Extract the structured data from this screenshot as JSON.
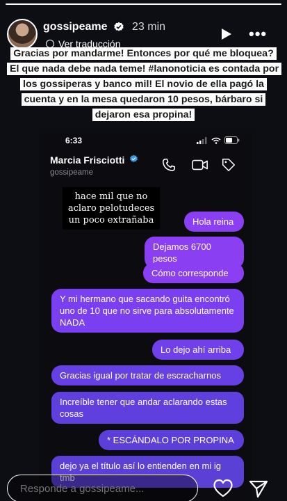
{
  "story": {
    "username": "gossipeame",
    "time_ago": "23 min",
    "translate_label": "Ver traducción",
    "caption": "Gracias por mandarme! Entonces por qué me bloquea? El que nada debe nada teme! #lanonoticia es contada por los gossiperas y banco mil! El novio de ella pagó la cuenta y en la mesa quedaron 10 pesos, bárbaro si dejaron esa propina!",
    "progress": 1.0
  },
  "chat": {
    "status_time": "6:33",
    "contact_name": "Marcia Frisciotti",
    "contact_handle": "gossipeame",
    "overlay_note": "hace mil que no aclaro pelotudeces un poco extrañaba",
    "messages": [
      {
        "text": "Hola reina",
        "color": "#8a3ff3"
      },
      {
        "text": "Dejamos 6700 pesos",
        "color": "#8a3ff3"
      },
      {
        "text": "Cómo corresponde",
        "color": "#8a3ff3"
      },
      {
        "text": "Y mi hermano que sacando guita encontró uno de 10 que no sirve para absolutamente NADA",
        "color": "#7a3ff0"
      },
      {
        "text": "Lo dejo ahí arriba",
        "color": "#7040ec"
      },
      {
        "text": "Gracias igual por tratar de escracharnos",
        "color": "#6640e4"
      },
      {
        "text": "Increíble tener que andar aclarando estas cosas",
        "color": "#5f3fde"
      },
      {
        "text": "* ESCÁNDALO POR PROPINA",
        "color": "#5b3fd8"
      },
      {
        "text": "dejo ya el título así lo entienden en mi ig tmb",
        "color": "#5a40d5"
      }
    ]
  },
  "reply_bar": {
    "placeholder": "Responde a gossipeame..."
  },
  "icons": {
    "verified": "verified-badge-icon",
    "play": "play-icon",
    "more": "more-options-icon",
    "call": "phone-call-icon",
    "video": "video-call-icon",
    "tag": "tag-icon",
    "heart": "heart-icon",
    "send": "send-icon",
    "globe": "globe-icon"
  },
  "colors": {
    "accent_purple": "#8a3ff3",
    "accent_indigo": "#5b3fd8",
    "verified_blue": "#3897f0"
  }
}
